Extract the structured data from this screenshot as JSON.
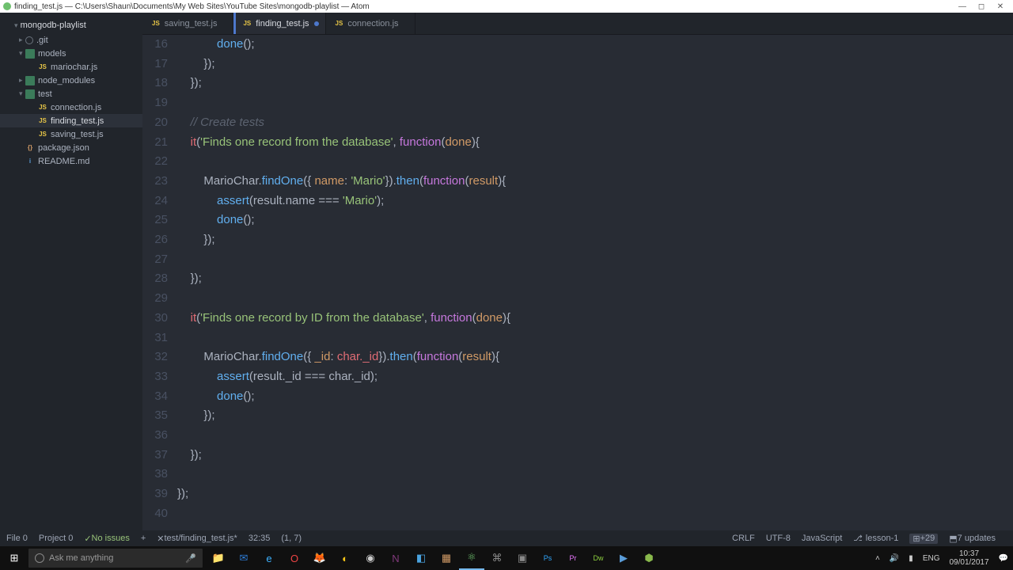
{
  "title": "finding_test.js — C:\\Users\\Shaun\\Documents\\My Web Sites\\YouTube Sites\\mongodb-playlist — Atom",
  "project_root": "mongodb-playlist",
  "tree": [
    {
      "label": ".git",
      "type": "git",
      "depth": 1,
      "expand": "▸"
    },
    {
      "label": "models",
      "type": "folder",
      "depth": 1,
      "expand": "▾"
    },
    {
      "label": "mariochar.js",
      "type": "js",
      "depth": 2,
      "expand": ""
    },
    {
      "label": "node_modules",
      "type": "folder",
      "depth": 1,
      "expand": "▸"
    },
    {
      "label": "test",
      "type": "folder",
      "depth": 1,
      "expand": "▾"
    },
    {
      "label": "connection.js",
      "type": "js",
      "depth": 2,
      "expand": ""
    },
    {
      "label": "finding_test.js",
      "type": "js",
      "depth": 2,
      "expand": "",
      "selected": true
    },
    {
      "label": "saving_test.js",
      "type": "js",
      "depth": 2,
      "expand": ""
    },
    {
      "label": "package.json",
      "type": "json",
      "depth": 1,
      "expand": ""
    },
    {
      "label": "README.md",
      "type": "md",
      "depth": 1,
      "expand": ""
    }
  ],
  "tabs": [
    {
      "label": "saving_test.js",
      "active": false,
      "dirty": false
    },
    {
      "label": "finding_test.js",
      "active": true,
      "dirty": true
    },
    {
      "label": "connection.js",
      "active": false,
      "dirty": false
    }
  ],
  "line_start": 16,
  "line_end": 40,
  "status": {
    "file": "File  0",
    "project": "Project  0",
    "issues": "No issues",
    "sel": "test/finding_test.js*",
    "ratio": "32:35",
    "pos": "(1, 7)",
    "crlf": "CRLF",
    "encoding": "UTF-8",
    "lang": "JavaScript",
    "branch": "lesson-1",
    "diff": "+29",
    "updates": "7 updates"
  },
  "taskbar": {
    "search_placeholder": "Ask me anything",
    "clock_time": "10:37",
    "clock_date": "09/01/2017",
    "lang": "ENG"
  }
}
